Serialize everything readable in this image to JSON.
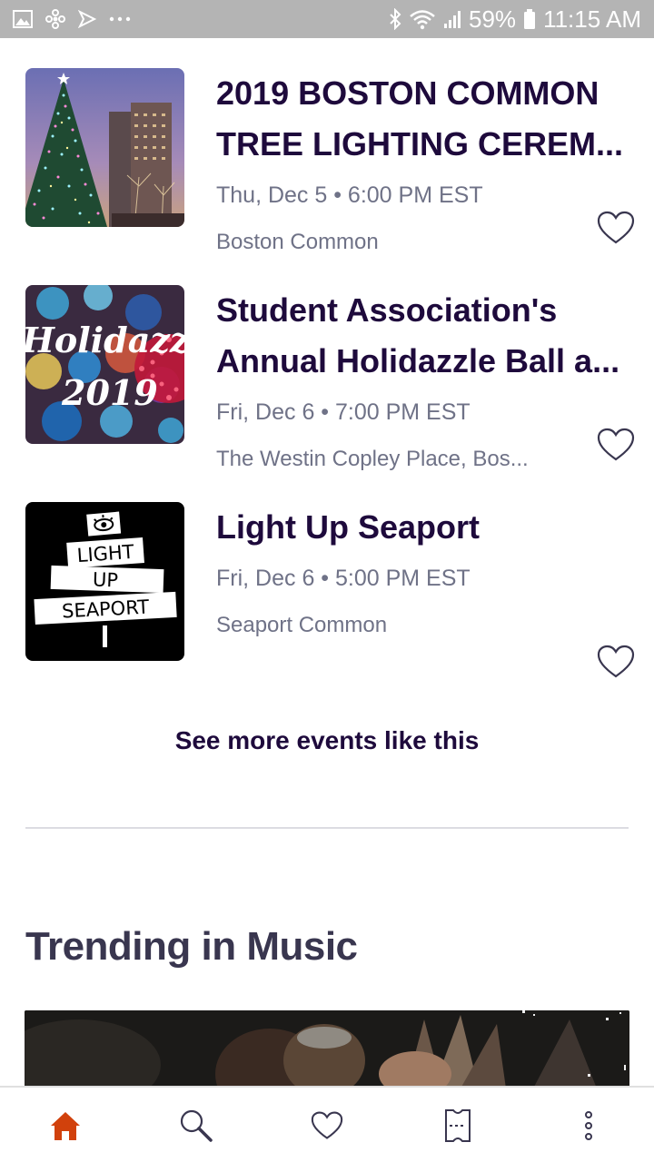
{
  "status_bar": {
    "battery": "59%",
    "time": "11:15 AM",
    "left_icons": [
      "gallery-icon",
      "fan-icon",
      "send-icon",
      "more-dots-icon"
    ],
    "right_icons": [
      "bluetooth-icon",
      "wifi-icon",
      "signal-icon",
      "battery-icon"
    ]
  },
  "events": [
    {
      "title_line1": "2019 BOSTON COMMON",
      "title_line2": "TREE LIGHTING CEREM...",
      "date": "Thu, Dec 5 • 6:00 PM EST",
      "venue": "Boston Common",
      "image": "christmas-tree-photo"
    },
    {
      "title_line1": "Student Association's",
      "title_line2": "Annual Holidazzle Ball a...",
      "date": "Fri, Dec 6 • 7:00 PM EST",
      "venue": "The Westin Copley Place, Bos...",
      "image": "holidazzle-photo",
      "image_text_1": "Holidazzle",
      "image_text_2": "2019"
    },
    {
      "title_line1": "Light Up Seaport",
      "date": "Fri, Dec 6 • 5:00 PM EST",
      "venue": "Seaport Common",
      "image": "light-up-seaport-logo",
      "image_text_1": "LIGHT",
      "image_text_2": "UP",
      "image_text_3": "SEAPORT"
    }
  ],
  "see_more_label": "See more events like this",
  "section_title": "Trending in Music",
  "bottom_nav": [
    {
      "name": "home",
      "icon": "home-icon",
      "active": true
    },
    {
      "name": "search",
      "icon": "search-icon"
    },
    {
      "name": "likes",
      "icon": "heart-icon"
    },
    {
      "name": "tickets",
      "icon": "ticket-icon"
    },
    {
      "name": "more",
      "icon": "more-vertical-icon"
    }
  ],
  "colors": {
    "title": "#1e0a3c",
    "meta": "#6f7287",
    "accent": "#d1410c",
    "status_bar": "#b4b4b4"
  }
}
